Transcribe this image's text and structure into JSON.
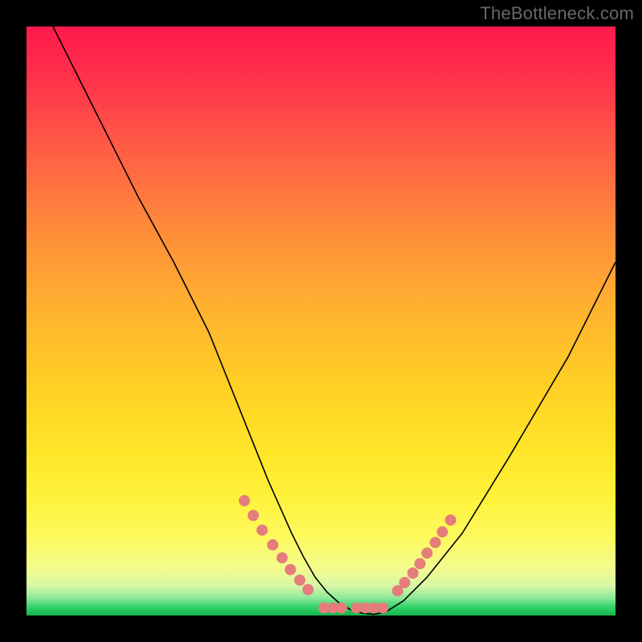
{
  "watermark": {
    "text": "TheBottleneck.com"
  },
  "colors": {
    "dot": "#e57d7d",
    "curve": "#000000",
    "frame_bg_top": "#ff1a4d",
    "frame_bg_bottom": "#11b44a",
    "page_bg": "#000000",
    "watermark_text": "#686868"
  },
  "chart_data": {
    "type": "line",
    "title": "",
    "xlabel": "",
    "ylabel": "",
    "xlim": [
      0,
      100
    ],
    "ylim": [
      0,
      100
    ],
    "grid": false,
    "legend": false,
    "notes": "No visible axis ticks or labels. Values below are percentages of the inner plot frame; x left→right, y bottom→top (0 at bottom, 100 at top). Curve is a V-shaped bottleneck curve starting top-left, dipping to a flat zero-plateau around x≈48–60, then rising to the right edge.",
    "series": [
      {
        "name": "curve",
        "x": [
          4.5,
          7,
          10,
          13,
          16,
          19,
          22,
          25,
          28,
          31,
          33,
          35,
          37,
          39,
          41,
          43,
          45,
          47,
          49,
          51,
          53,
          55,
          57,
          59,
          61,
          64,
          68,
          74,
          82,
          92,
          100
        ],
        "y": [
          100,
          95,
          89,
          83,
          77,
          71,
          65.5,
          60,
          54,
          48,
          43,
          38,
          33,
          28,
          23,
          18.5,
          14,
          10,
          6.5,
          4,
          2.2,
          1.0,
          0.4,
          0.2,
          0.6,
          2.5,
          6.5,
          14,
          27,
          44,
          60
        ]
      }
    ],
    "dots_left_cluster": {
      "comment": "salmon dots on the descending arm",
      "x": [
        37.0,
        38.5,
        40.0,
        41.8,
        43.4,
        44.8,
        46.4,
        47.8
      ],
      "y": [
        19.5,
        17.0,
        14.5,
        12.0,
        9.8,
        7.8,
        6.0,
        4.4
      ]
    },
    "dots_bottom_cluster": {
      "comment": "salmon dots along the flat bottom",
      "x": [
        50.5,
        52.0,
        53.5,
        56.0,
        57.5,
        59.0,
        60.5
      ],
      "y": [
        1.3,
        1.3,
        1.3,
        1.3,
        1.3,
        1.3,
        1.3
      ]
    },
    "dots_right_cluster": {
      "comment": "salmon dots on the ascending arm",
      "x": [
        63.0,
        64.2,
        65.6,
        66.8,
        68.0,
        69.4,
        70.6,
        72.0
      ],
      "y": [
        4.2,
        5.6,
        7.2,
        8.8,
        10.6,
        12.4,
        14.2,
        16.2
      ]
    },
    "dot_radius_px": 7
  }
}
